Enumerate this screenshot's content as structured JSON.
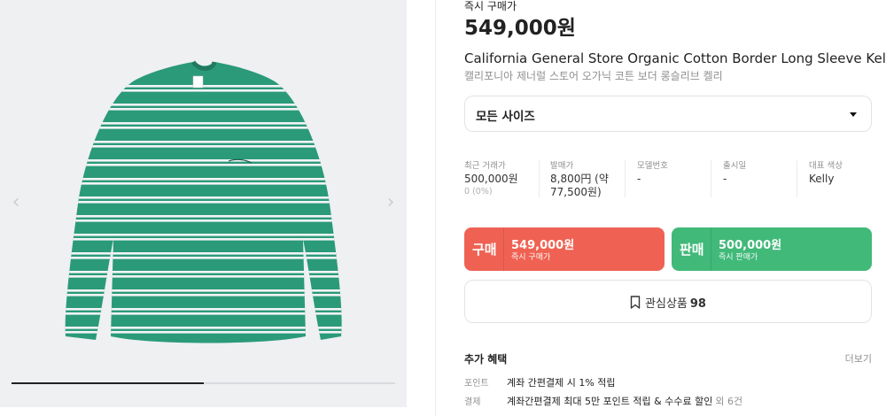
{
  "gallery": {
    "prev_arrow": "‹",
    "next_arrow": "›",
    "progress": 0.5,
    "shirt_color": "#2b9a78",
    "stripe_color": "#f3f4f5"
  },
  "product": {
    "price_label": "즉시 구매가",
    "price": "549,000원",
    "title_en": "California General Store Organic Cotton Border Long Sleeve Kelly",
    "title_ko": "캘리포니아 제너럴 스토어 오가닉 코튼 보더 롱슬리브 켈리"
  },
  "size_select": {
    "value": "모든 사이즈",
    "icon": "caret-down-icon"
  },
  "stats": [
    {
      "label": "최근 거래가",
      "value": "500,000원",
      "sub": "0 (0%)"
    },
    {
      "label": "발매가",
      "value": "8,800円 (약 77,500원)",
      "sub": ""
    },
    {
      "label": "모델번호",
      "value": "-",
      "sub": ""
    },
    {
      "label": "출시일",
      "value": "-",
      "sub": ""
    },
    {
      "label": "대표 색상",
      "value": "Kelly",
      "sub": ""
    }
  ],
  "actions": {
    "buy": {
      "title": "구매",
      "price": "549,000원",
      "sub": "즉시 구매가",
      "color": "#ef6253"
    },
    "sell": {
      "title": "판매",
      "price": "500,000원",
      "sub": "즉시 판매가",
      "color": "#41b979"
    }
  },
  "wishlist": {
    "label": "관심상품",
    "count": "98",
    "icon": "bookmark-icon"
  },
  "benefits": {
    "title": "추가 혜택",
    "more": "더보기",
    "rows": [
      {
        "key": "포인트",
        "text": "계좌 간편결제 시 1% 적립",
        "extra": ""
      },
      {
        "key": "결제",
        "text": "계좌간편결제 최대 5만 포인트 적립 & 수수료 할인",
        "extra": "외 6건"
      }
    ]
  }
}
